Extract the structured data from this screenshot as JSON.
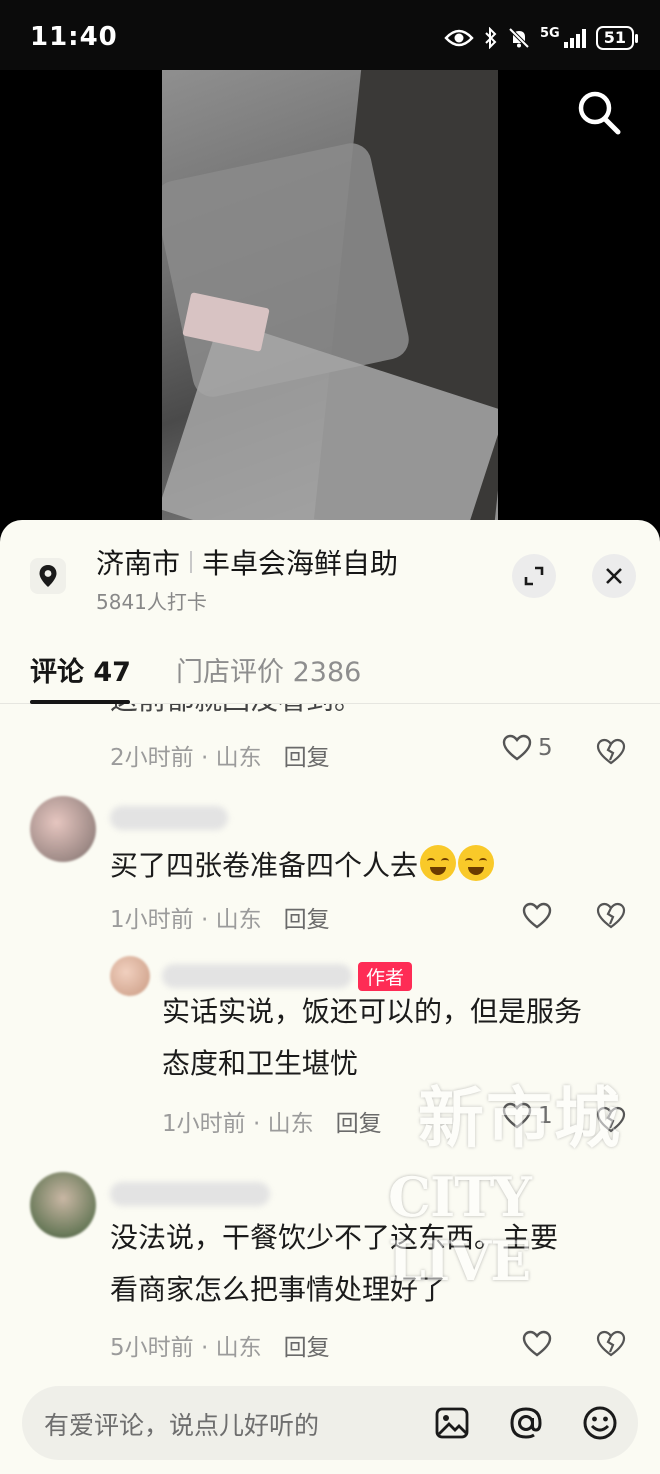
{
  "status_bar": {
    "time": "11:40",
    "network": "5G",
    "battery": "51"
  },
  "video": {
    "search_icon": "search-icon"
  },
  "location": {
    "city": "济南市",
    "place": "丰卓会海鲜自助",
    "checkins": "5841人打卡"
  },
  "tabs": [
    {
      "label": "评论 47",
      "active": true
    },
    {
      "label": "门店评价 2386",
      "active": false
    }
  ],
  "comments": [
    {
      "text": "这前都就回没看到。",
      "time": "2小时前",
      "region": "山东",
      "reply": "回复",
      "likes": "5"
    },
    {
      "text": "买了四张卷准备四个人去",
      "emoji_count": 2,
      "time": "1小时前",
      "region": "山东",
      "reply": "回复",
      "likes": ""
    },
    {
      "is_reply": true,
      "badge": "作者",
      "text_line1": "实话实说，饭还可以的，但是服务",
      "text_line2": "态度和卫生堪忧",
      "time": "1小时前",
      "region": "山东",
      "reply": "回复",
      "likes": "1"
    },
    {
      "text_line1": "没法说，干餐饮少不了这东西。主要",
      "text_line2": "看商家怎么把事情处理好了",
      "time": "5小时前",
      "region": "山东",
      "reply": "回复",
      "likes": ""
    }
  ],
  "input": {
    "placeholder": "有爱评论，说点儿好听的"
  },
  "watermark": {
    "top": "新市城",
    "bottom": "CITY LIVE"
  },
  "colors": {
    "accent": "#fe2c55",
    "sheet": "#fbfbf3"
  }
}
